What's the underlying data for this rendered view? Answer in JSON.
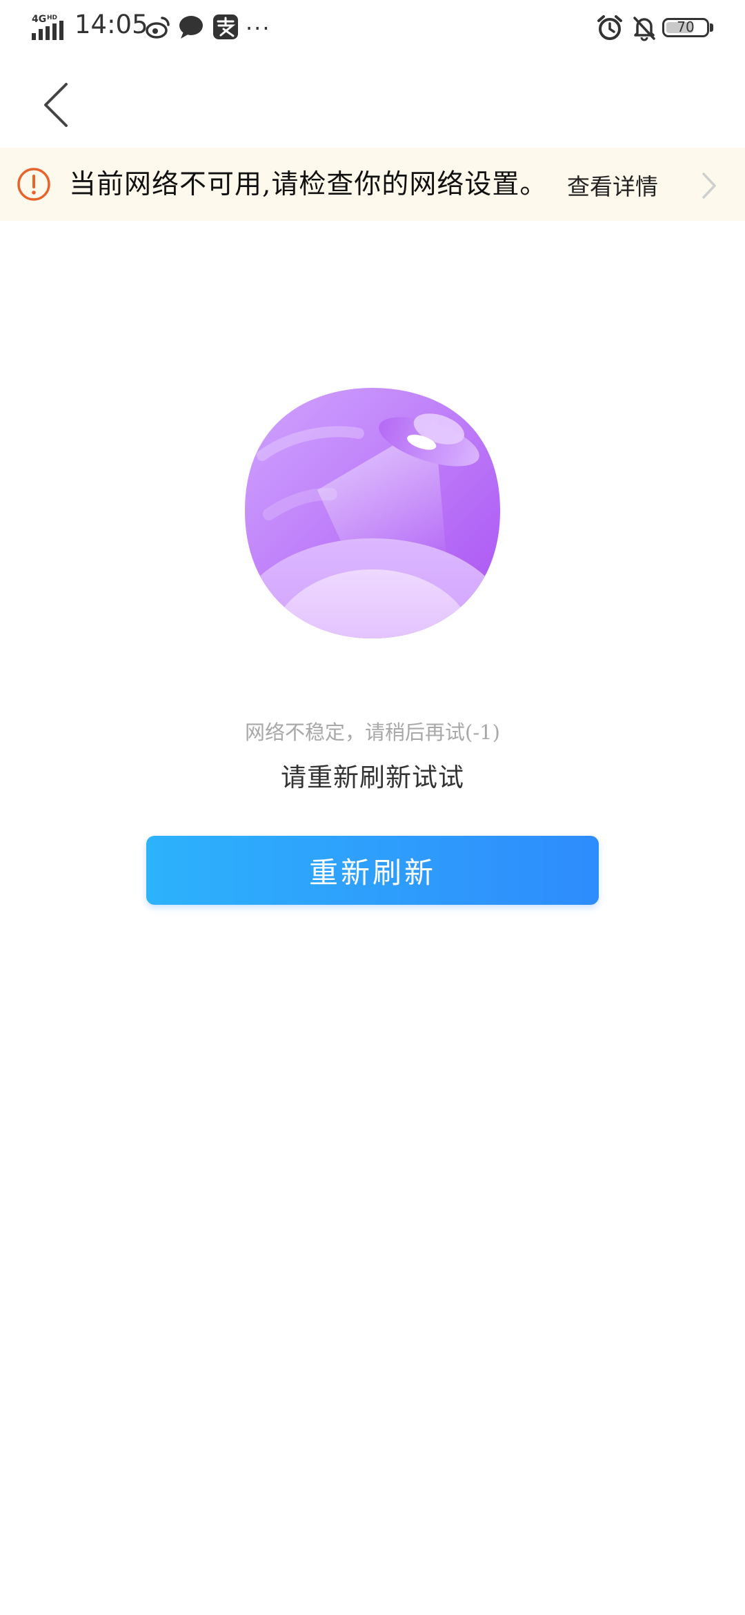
{
  "status_bar": {
    "network": "4G HD",
    "time": "14:05",
    "notification_icons": [
      "weibo-icon",
      "chat-bubble-icon",
      "alipay-icon",
      "more-dots-icon"
    ],
    "more": "···",
    "right_icons": [
      "alarm-icon",
      "bell-muted-icon",
      "battery-icon"
    ],
    "battery_level": 70,
    "battery_label": "70"
  },
  "nav": {
    "back_icon": "chevron-left-icon"
  },
  "banner": {
    "icon": "alert-circle-icon",
    "message": "当前网络不可用,请检查你的网络设置。",
    "link": "查看详情",
    "chevron_icon": "chevron-right-icon",
    "background_color": "#fdf9ec",
    "icon_color": "#e8632c"
  },
  "main": {
    "illustration": "ufo-planet-illustration",
    "error_message": "网络不稳定，请稍后再试(-1)",
    "retry_prompt": "请重新刷新试试",
    "refresh_button": "重新刷新",
    "button_colors": [
      "#2db2fc",
      "#2e8cfc"
    ]
  }
}
